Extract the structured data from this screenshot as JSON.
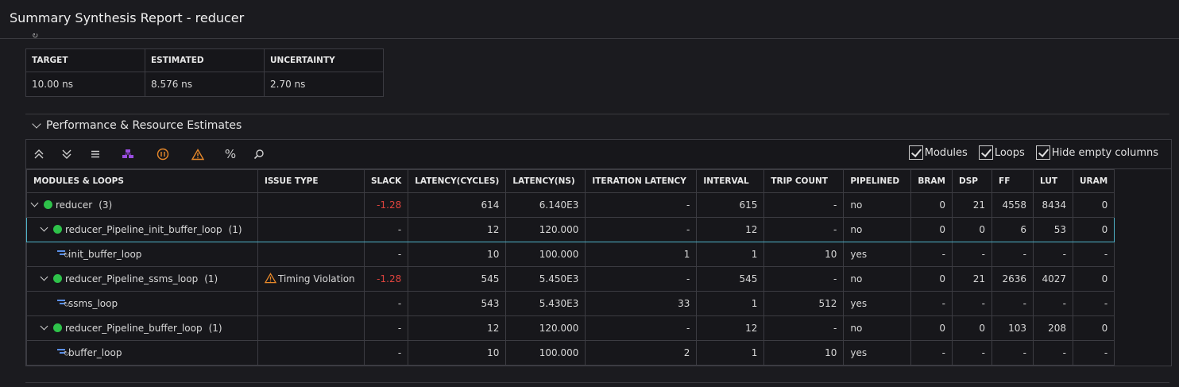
{
  "header": {
    "title": "Summary Synthesis Report - reducer"
  },
  "timing": {
    "headers": [
      "TARGET",
      "ESTIMATED",
      "UNCERTAINTY"
    ],
    "values": [
      "10.00 ns",
      "8.576 ns",
      "2.70 ns"
    ]
  },
  "perf": {
    "section_title": "Performance & Resource Estimates",
    "toolbar": {
      "icons": [
        "expand-all-icon",
        "collapse-all-icon",
        "list-icon",
        "hierarchy-icon",
        "pipeline-icon",
        "warning-icon",
        "percent-icon",
        "search-icon"
      ],
      "checks": [
        {
          "label": "Modules",
          "checked": true
        },
        {
          "label": "Loops",
          "checked": true
        },
        {
          "label": "Hide empty columns",
          "checked": true
        }
      ]
    },
    "columns": [
      "MODULES & LOOPS",
      "ISSUE TYPE",
      "SLACK",
      "LATENCY(CYCLES)",
      "LATENCY(NS)",
      "ITERATION LATENCY",
      "INTERVAL",
      "TRIP COUNT",
      "PIPELINED",
      "BRAM",
      "DSP",
      "FF",
      "LUT",
      "URAM"
    ],
    "rows": [
      {
        "name": "reducer",
        "count": "(3)",
        "kind": "module",
        "level": 0,
        "issue": "",
        "slack": "-1.28",
        "lat_cycles": "614",
        "lat_ns": "6.140E3",
        "iter_lat": "-",
        "interval": "615",
        "trip": "-",
        "pipelined": "no",
        "bram": "0",
        "dsp": "21",
        "ff": "4558",
        "lut": "8434",
        "uram": "0"
      },
      {
        "name": "reducer_Pipeline_init_buffer_loop",
        "count": "(1)",
        "kind": "module",
        "level": 1,
        "issue": "",
        "slack": "-",
        "lat_cycles": "12",
        "lat_ns": "120.000",
        "iter_lat": "-",
        "interval": "12",
        "trip": "-",
        "pipelined": "no",
        "bram": "0",
        "dsp": "0",
        "ff": "6",
        "lut": "53",
        "uram": "0"
      },
      {
        "name": "init_buffer_loop",
        "count": "",
        "kind": "loop",
        "level": 2,
        "issue": "",
        "slack": "-",
        "lat_cycles": "10",
        "lat_ns": "100.000",
        "iter_lat": "1",
        "interval": "1",
        "trip": "10",
        "pipelined": "yes",
        "bram": "-",
        "dsp": "-",
        "ff": "-",
        "lut": "-",
        "uram": "-"
      },
      {
        "name": "reducer_Pipeline_ssms_loop",
        "count": "(1)",
        "kind": "module",
        "level": 1,
        "issue": "Timing Violation",
        "slack": "-1.28",
        "lat_cycles": "545",
        "lat_ns": "5.450E3",
        "iter_lat": "-",
        "interval": "545",
        "trip": "-",
        "pipelined": "no",
        "bram": "0",
        "dsp": "21",
        "ff": "2636",
        "lut": "4027",
        "uram": "0"
      },
      {
        "name": "ssms_loop",
        "count": "",
        "kind": "loop",
        "level": 2,
        "issue": "",
        "slack": "-",
        "lat_cycles": "543",
        "lat_ns": "5.430E3",
        "iter_lat": "33",
        "interval": "1",
        "trip": "512",
        "pipelined": "yes",
        "bram": "-",
        "dsp": "-",
        "ff": "-",
        "lut": "-",
        "uram": "-"
      },
      {
        "name": "reducer_Pipeline_buffer_loop",
        "count": "(1)",
        "kind": "module",
        "level": 1,
        "issue": "",
        "slack": "-",
        "lat_cycles": "12",
        "lat_ns": "120.000",
        "iter_lat": "-",
        "interval": "12",
        "trip": "-",
        "pipelined": "no",
        "bram": "0",
        "dsp": "0",
        "ff": "103",
        "lut": "208",
        "uram": "0"
      },
      {
        "name": "buffer_loop",
        "count": "",
        "kind": "loop",
        "level": 2,
        "issue": "",
        "slack": "-",
        "lat_cycles": "10",
        "lat_ns": "100.000",
        "iter_lat": "2",
        "interval": "1",
        "trip": "10",
        "pipelined": "yes",
        "bram": "-",
        "dsp": "-",
        "ff": "-",
        "lut": "-",
        "uram": "-"
      }
    ],
    "selected_row": 1
  },
  "colors": {
    "slack_negative": "#e0443e",
    "module_ok": "#2ec24a",
    "warning": "#e8892a",
    "selection": "#4fb3c9",
    "loop_icon": "#5b8fe8"
  }
}
